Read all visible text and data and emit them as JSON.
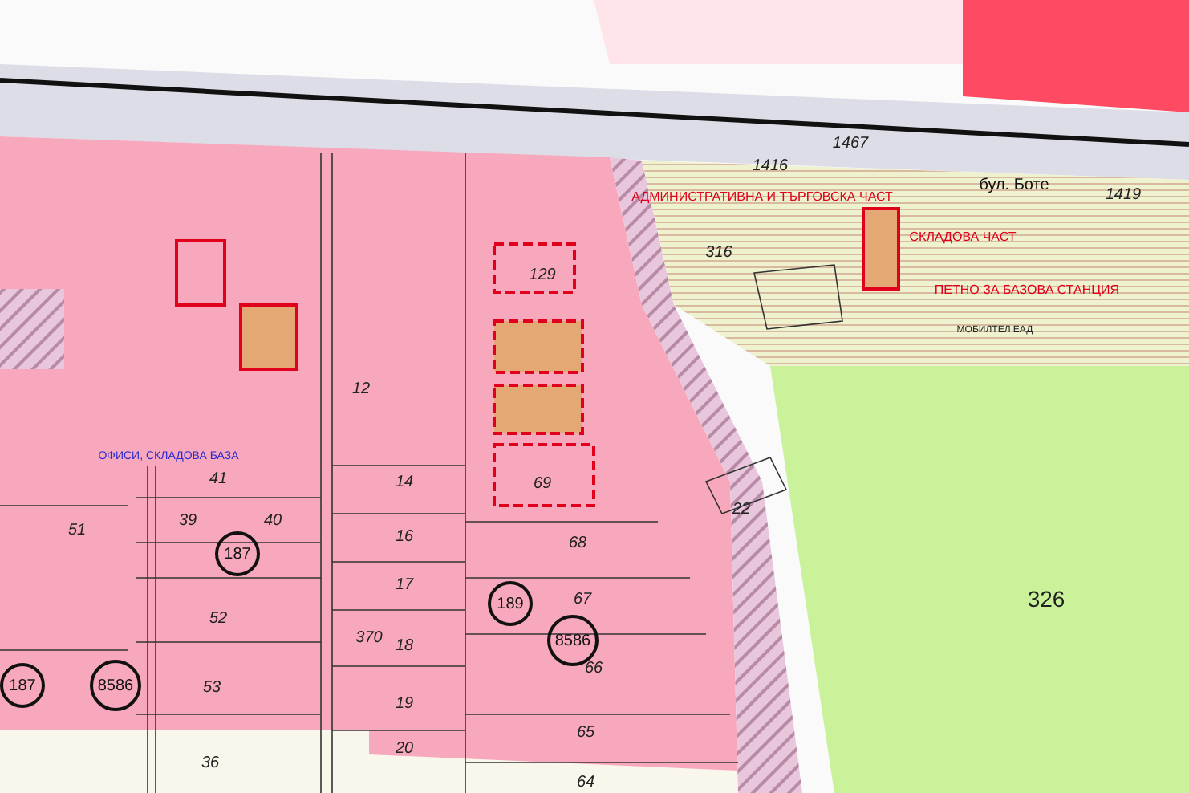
{
  "map": {
    "labels": [
      {
        "kind": "street",
        "text": "бул. Боте"
      },
      {
        "kind": "zone",
        "text": "АДМИНИСТРАТИВНА И ТЪРГОВСКА ЧАСТ"
      },
      {
        "kind": "zone",
        "text": "СКЛАДОВА ЧАСТ"
      },
      {
        "kind": "zone",
        "text": "ПЕТНО ЗА БАЗОВА СТАНЦИЯ"
      },
      {
        "kind": "company",
        "text": "МОБИЛТЕЛ ЕАД"
      },
      {
        "kind": "area",
        "text": "326"
      },
      {
        "kind": "parcel",
        "text": "1467"
      },
      {
        "kind": "parcel",
        "text": "1416"
      },
      {
        "kind": "parcel",
        "text": "316"
      },
      {
        "kind": "parcel",
        "text": "1419"
      },
      {
        "kind": "parcel",
        "text": "22"
      },
      {
        "kind": "circled",
        "text": "187"
      },
      {
        "kind": "circled",
        "text": "189"
      },
      {
        "kind": "circled",
        "text": "8586"
      },
      {
        "kind": "circled",
        "text": "187"
      },
      {
        "kind": "circled",
        "text": "8586"
      },
      {
        "kind": "use",
        "text": "ОФИСИ, СКЛАДОВА БАЗА"
      },
      {
        "kind": "parcel",
        "text": "41"
      },
      {
        "kind": "parcel",
        "text": "39"
      },
      {
        "kind": "parcel",
        "text": "40"
      },
      {
        "kind": "parcel",
        "text": "51"
      },
      {
        "kind": "parcel",
        "text": "52"
      },
      {
        "kind": "parcel",
        "text": "53"
      },
      {
        "kind": "parcel",
        "text": "36"
      },
      {
        "kind": "parcel",
        "text": "12"
      },
      {
        "kind": "parcel",
        "text": "14"
      },
      {
        "kind": "parcel",
        "text": "16"
      },
      {
        "kind": "parcel",
        "text": "17"
      },
      {
        "kind": "parcel",
        "text": "18"
      },
      {
        "kind": "parcel",
        "text": "19"
      },
      {
        "kind": "parcel",
        "text": "20"
      },
      {
        "kind": "parcel",
        "text": "68"
      },
      {
        "kind": "parcel",
        "text": "67"
      },
      {
        "kind": "parcel",
        "text": "66"
      },
      {
        "kind": "parcel",
        "text": "65"
      },
      {
        "kind": "parcel",
        "text": "64"
      },
      {
        "kind": "parcel",
        "text": "69"
      },
      {
        "kind": "parcel",
        "text": "129"
      },
      {
        "kind": "parcel",
        "text": "370"
      }
    ]
  }
}
